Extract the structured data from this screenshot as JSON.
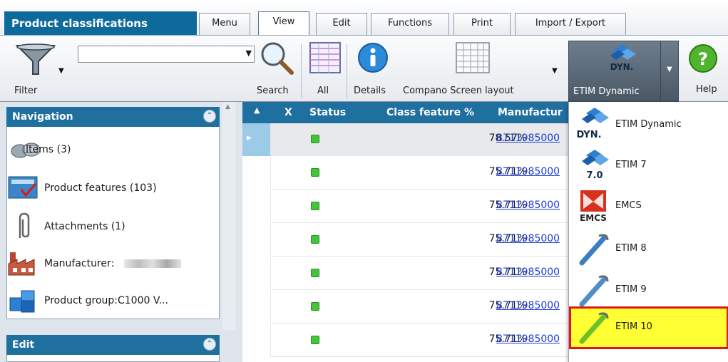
{
  "app": {
    "title": "Product classifications"
  },
  "tabs": [
    {
      "label": "Menu"
    },
    {
      "label": "View"
    },
    {
      "label": "Edit"
    },
    {
      "label": "Functions"
    },
    {
      "label": "Print"
    },
    {
      "label": "Import / Export"
    }
  ],
  "ribbon": {
    "filter_label": "Filter",
    "search_label": "Search",
    "search_value": "",
    "all_label": "All",
    "details_label": "Details",
    "screen_layout_label": "Compano Screen layout",
    "etim_label": "ETIM Dynamic",
    "etim_icon_text": "DYN.",
    "help_label": "Help"
  },
  "navigation": {
    "title": "Navigation",
    "items": [
      {
        "label": "Items (3)",
        "icon": "items-icon"
      },
      {
        "label": "Product features (103)",
        "icon": "product-features-icon"
      },
      {
        "label": "Attachments (1)",
        "icon": "paperclip-icon"
      },
      {
        "label": "Manufacturer:",
        "icon": "factory-icon"
      },
      {
        "label": "Product group:C1000 V...",
        "icon": "product-group-icon"
      }
    ]
  },
  "edit_panel": {
    "title": "Edit"
  },
  "grid": {
    "columns": {
      "x": "X",
      "status": "Status",
      "class_feature": "Class feature %",
      "manufacturer": "Manufactur"
    },
    "rows": [
      {
        "pct": "78.57%",
        "mfr": "8711985000"
      },
      {
        "pct": "75.71%",
        "mfr": "8711985000"
      },
      {
        "pct": "75.71%",
        "mfr": "8711985000"
      },
      {
        "pct": "75.71%",
        "mfr": "8711985000"
      },
      {
        "pct": "75.71%",
        "mfr": "8711985000"
      },
      {
        "pct": "75.71%",
        "mfr": "8711985000"
      },
      {
        "pct": "75.71%",
        "mfr": "8711985000"
      }
    ]
  },
  "etim_menu": {
    "items": [
      {
        "label": "ETIM Dynamic",
        "badge": "DYN."
      },
      {
        "label": "ETIM 7",
        "badge": "7.0"
      },
      {
        "label": "EMCS",
        "badge": "EMCS"
      },
      {
        "label": "ETIM 8",
        "badge": ""
      },
      {
        "label": "ETIM 9",
        "badge": ""
      },
      {
        "label": "ETIM 10",
        "badge": ""
      }
    ],
    "highlight_color": "#ffff33",
    "highlight_border": "#e0161a"
  },
  "colors": {
    "brand": "#0f6a9c",
    "status_ok": "#45c43a",
    "link": "#1e3ad6"
  }
}
